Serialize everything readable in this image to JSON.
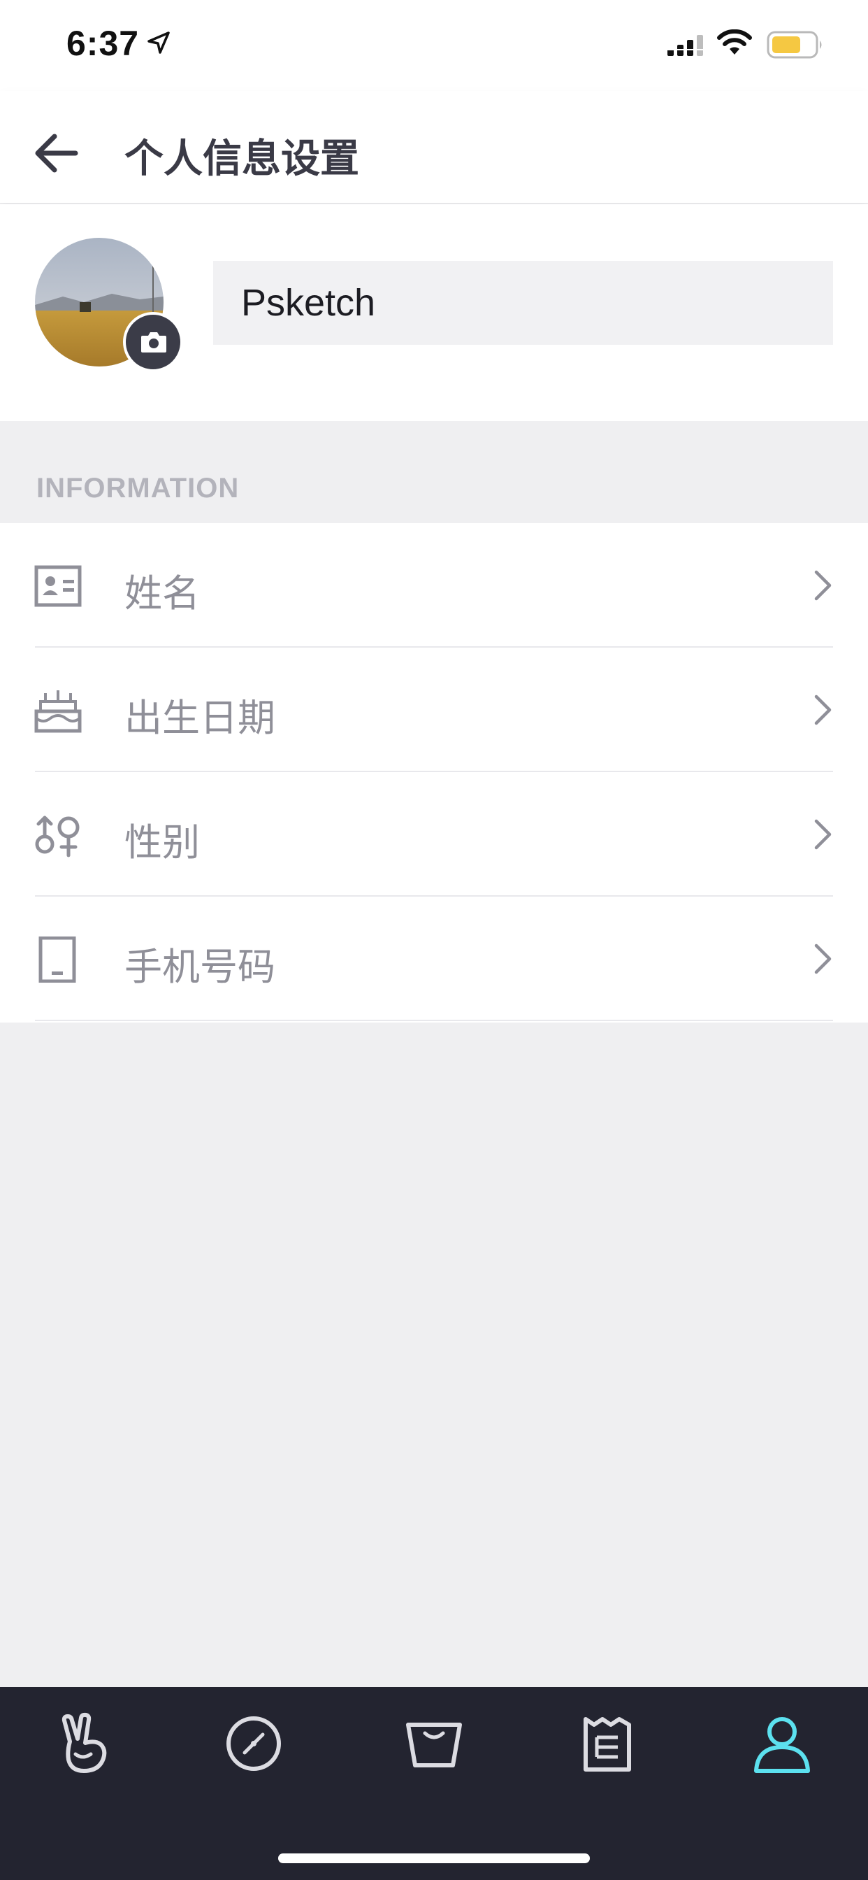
{
  "status_bar": {
    "time": "6:37"
  },
  "nav": {
    "title": "个人信息设置"
  },
  "profile": {
    "name": "Psketch"
  },
  "section": {
    "title": "INFORMATION"
  },
  "info_items": [
    {
      "label": "姓名",
      "icon": "id-card-icon"
    },
    {
      "label": "出生日期",
      "icon": "birthday-cake-icon"
    },
    {
      "label": "性别",
      "icon": "gender-icon"
    },
    {
      "label": "手机号码",
      "icon": "phone-icon"
    }
  ],
  "tab_bar": {
    "tabs": [
      {
        "icon": "peace-hand-icon",
        "active": false
      },
      {
        "icon": "compass-icon",
        "active": false
      },
      {
        "icon": "basket-icon",
        "active": false
      },
      {
        "icon": "receipt-icon",
        "active": false
      },
      {
        "icon": "user-icon",
        "active": true
      }
    ],
    "active_color": "#5ce1ef",
    "inactive_color": "#dcdce2"
  },
  "colors": {
    "background": "#efeff1",
    "tab_bar": "#232430"
  }
}
